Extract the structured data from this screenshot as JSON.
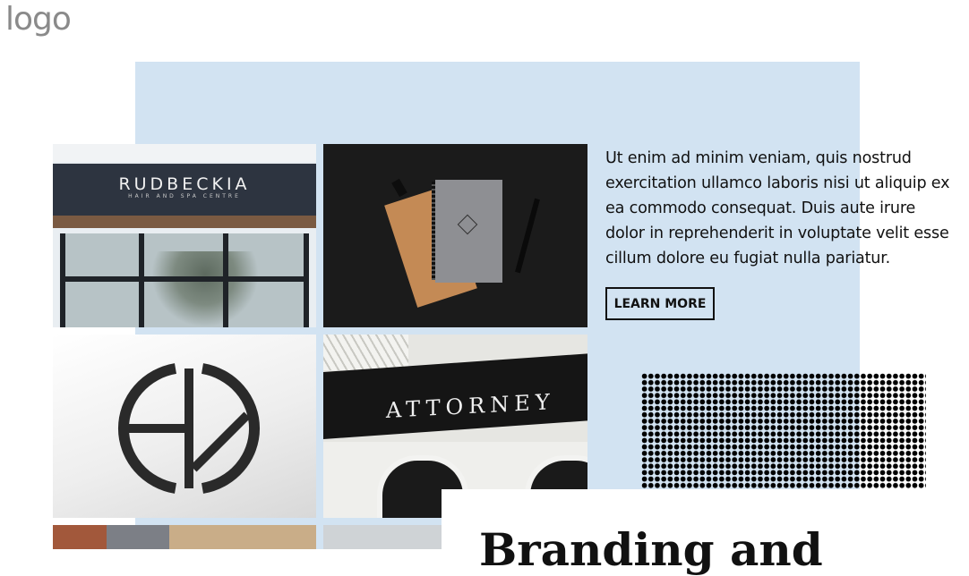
{
  "header": {
    "logo_text": "logo"
  },
  "gallery": {
    "tiles": [
      {
        "name": "storefront",
        "sign_text": "RUDBECKIA",
        "sign_subtext": "HAIR AND SPA CENTRE"
      },
      {
        "name": "notebook"
      },
      {
        "name": "ep-logo"
      },
      {
        "name": "attorney-sign",
        "sign_text": "ATTORNEY"
      }
    ]
  },
  "feature": {
    "body": "Ut enim ad minim veniam, quis nostrud exercitation ullamco laboris nisi ut aliquip ex ea commodo consequat. Duis aute irure dolor in reprehenderit in voluptate velit esse cillum dolore eu fugiat nulla pariatur.",
    "button_label": "LEARN MORE"
  },
  "card": {
    "title": "Branding and"
  },
  "colors": {
    "panel": "#d2e3f2",
    "text": "#111111",
    "logo": "#8a8a8a"
  }
}
